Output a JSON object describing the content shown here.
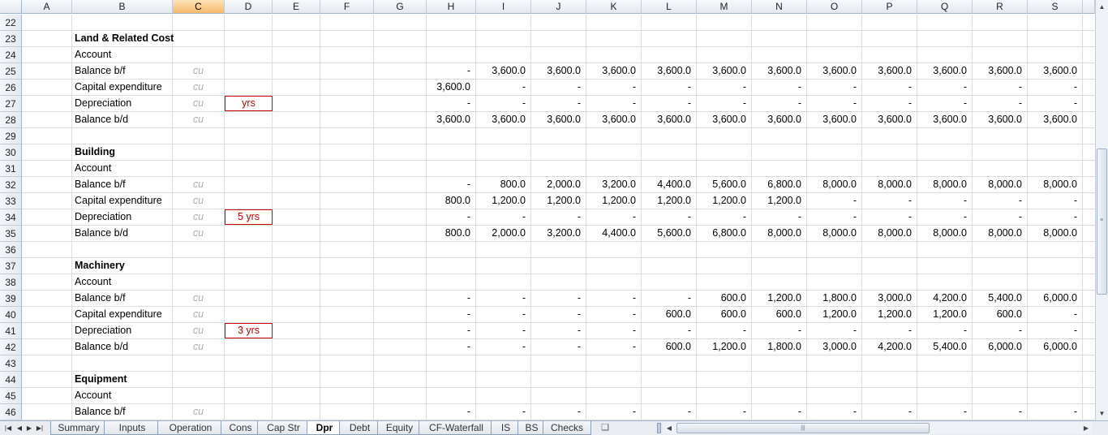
{
  "columns": [
    "A",
    "B",
    "C",
    "D",
    "E",
    "F",
    "G",
    "H",
    "I",
    "J",
    "K",
    "L",
    "M",
    "N",
    "O",
    "P",
    "Q",
    "R",
    "S"
  ],
  "selected_column": "C",
  "rows": [
    {
      "num": "22",
      "b": "",
      "bold": false,
      "unit": "",
      "box": "",
      "vals": [
        "",
        "",
        "",
        "",
        "",
        "",
        "",
        "",
        "",
        "",
        "",
        ""
      ]
    },
    {
      "num": "23",
      "b": "Land & Related Cost",
      "bold": true,
      "unit": "",
      "box": "",
      "vals": [
        "",
        "",
        "",
        "",
        "",
        "",
        "",
        "",
        "",
        "",
        "",
        ""
      ]
    },
    {
      "num": "24",
      "b": "Account",
      "bold": false,
      "unit": "",
      "box": "",
      "vals": [
        "",
        "",
        "",
        "",
        "",
        "",
        "",
        "",
        "",
        "",
        "",
        ""
      ]
    },
    {
      "num": "25",
      "b": "Balance b/f",
      "bold": false,
      "unit": "cu",
      "box": "",
      "vals": [
        "-",
        "3,600.0",
        "3,600.0",
        "3,600.0",
        "3,600.0",
        "3,600.0",
        "3,600.0",
        "3,600.0",
        "3,600.0",
        "3,600.0",
        "3,600.0",
        "3,600.0"
      ]
    },
    {
      "num": "26",
      "b": "Capital expenditure",
      "bold": false,
      "unit": "cu",
      "box": "",
      "vals": [
        "3,600.0",
        "-",
        "-",
        "-",
        "-",
        "-",
        "-",
        "-",
        "-",
        "-",
        "-",
        "-"
      ]
    },
    {
      "num": "27",
      "b": "Depreciation",
      "bold": false,
      "unit": "cu",
      "box": "yrs",
      "vals": [
        "-",
        "-",
        "-",
        "-",
        "-",
        "-",
        "-",
        "-",
        "-",
        "-",
        "-",
        "-"
      ]
    },
    {
      "num": "28",
      "b": "Balance b/d",
      "bold": false,
      "unit": "cu",
      "box": "",
      "vals": [
        "3,600.0",
        "3,600.0",
        "3,600.0",
        "3,600.0",
        "3,600.0",
        "3,600.0",
        "3,600.0",
        "3,600.0",
        "3,600.0",
        "3,600.0",
        "3,600.0",
        "3,600.0"
      ]
    },
    {
      "num": "29",
      "b": "",
      "bold": false,
      "unit": "",
      "box": "",
      "vals": [
        "",
        "",
        "",
        "",
        "",
        "",
        "",
        "",
        "",
        "",
        "",
        ""
      ]
    },
    {
      "num": "30",
      "b": "Building",
      "bold": true,
      "unit": "",
      "box": "",
      "vals": [
        "",
        "",
        "",
        "",
        "",
        "",
        "",
        "",
        "",
        "",
        "",
        ""
      ]
    },
    {
      "num": "31",
      "b": "Account",
      "bold": false,
      "unit": "",
      "box": "",
      "vals": [
        "",
        "",
        "",
        "",
        "",
        "",
        "",
        "",
        "",
        "",
        "",
        ""
      ]
    },
    {
      "num": "32",
      "b": "Balance b/f",
      "bold": false,
      "unit": "cu",
      "box": "",
      "vals": [
        "-",
        "800.0",
        "2,000.0",
        "3,200.0",
        "4,400.0",
        "5,600.0",
        "6,800.0",
        "8,000.0",
        "8,000.0",
        "8,000.0",
        "8,000.0",
        "8,000.0"
      ]
    },
    {
      "num": "33",
      "b": "Capital expenditure",
      "bold": false,
      "unit": "cu",
      "box": "",
      "vals": [
        "800.0",
        "1,200.0",
        "1,200.0",
        "1,200.0",
        "1,200.0",
        "1,200.0",
        "1,200.0",
        "-",
        "-",
        "-",
        "-",
        "-"
      ]
    },
    {
      "num": "34",
      "b": "Depreciation",
      "bold": false,
      "unit": "cu",
      "box": "5 yrs",
      "vals": [
        "-",
        "-",
        "-",
        "-",
        "-",
        "-",
        "-",
        "-",
        "-",
        "-",
        "-",
        "-"
      ]
    },
    {
      "num": "35",
      "b": "Balance b/d",
      "bold": false,
      "unit": "cu",
      "box": "",
      "vals": [
        "800.0",
        "2,000.0",
        "3,200.0",
        "4,400.0",
        "5,600.0",
        "6,800.0",
        "8,000.0",
        "8,000.0",
        "8,000.0",
        "8,000.0",
        "8,000.0",
        "8,000.0"
      ]
    },
    {
      "num": "36",
      "b": "",
      "bold": false,
      "unit": "",
      "box": "",
      "vals": [
        "",
        "",
        "",
        "",
        "",
        "",
        "",
        "",
        "",
        "",
        "",
        ""
      ]
    },
    {
      "num": "37",
      "b": "Machinery",
      "bold": true,
      "unit": "",
      "box": "",
      "vals": [
        "",
        "",
        "",
        "",
        "",
        "",
        "",
        "",
        "",
        "",
        "",
        ""
      ]
    },
    {
      "num": "38",
      "b": "Account",
      "bold": false,
      "unit": "",
      "box": "",
      "vals": [
        "",
        "",
        "",
        "",
        "",
        "",
        "",
        "",
        "",
        "",
        "",
        ""
      ]
    },
    {
      "num": "39",
      "b": "Balance b/f",
      "bold": false,
      "unit": "cu",
      "box": "",
      "vals": [
        "-",
        "-",
        "-",
        "-",
        "-",
        "600.0",
        "1,200.0",
        "1,800.0",
        "3,000.0",
        "4,200.0",
        "5,400.0",
        "6,000.0"
      ]
    },
    {
      "num": "40",
      "b": "Capital expenditure",
      "bold": false,
      "unit": "cu",
      "box": "",
      "vals": [
        "-",
        "-",
        "-",
        "-",
        "600.0",
        "600.0",
        "600.0",
        "1,200.0",
        "1,200.0",
        "1,200.0",
        "600.0",
        "-"
      ]
    },
    {
      "num": "41",
      "b": "Depreciation",
      "bold": false,
      "unit": "cu",
      "box": "3 yrs",
      "vals": [
        "-",
        "-",
        "-",
        "-",
        "-",
        "-",
        "-",
        "-",
        "-",
        "-",
        "-",
        "-"
      ]
    },
    {
      "num": "42",
      "b": "Balance b/d",
      "bold": false,
      "unit": "cu",
      "box": "",
      "vals": [
        "-",
        "-",
        "-",
        "-",
        "600.0",
        "1,200.0",
        "1,800.0",
        "3,000.0",
        "4,200.0",
        "5,400.0",
        "6,000.0",
        "6,000.0"
      ]
    },
    {
      "num": "43",
      "b": "",
      "bold": false,
      "unit": "",
      "box": "",
      "vals": [
        "",
        "",
        "",
        "",
        "",
        "",
        "",
        "",
        "",
        "",
        "",
        ""
      ]
    },
    {
      "num": "44",
      "b": "Equipment",
      "bold": true,
      "unit": "",
      "box": "",
      "vals": [
        "",
        "",
        "",
        "",
        "",
        "",
        "",
        "",
        "",
        "",
        "",
        ""
      ]
    },
    {
      "num": "45",
      "b": "Account",
      "bold": false,
      "unit": "",
      "box": "",
      "vals": [
        "",
        "",
        "",
        "",
        "",
        "",
        "",
        "",
        "",
        "",
        "",
        ""
      ]
    },
    {
      "num": "46",
      "b": "Balance b/f",
      "bold": false,
      "unit": "cu",
      "box": "",
      "vals": [
        "-",
        "-",
        "-",
        "-",
        "-",
        "-",
        "-",
        "-",
        "-",
        "-",
        "-",
        "-"
      ]
    }
  ],
  "tabs": [
    "Summary",
    "Inputs",
    "Operation",
    "Cons",
    "Cap Str",
    "Dpr",
    "Debt",
    "Equity",
    "CF-Waterfall",
    "IS",
    "BS",
    "Checks"
  ],
  "active_tab": "Dpr",
  "icons": {
    "nav_first": "first-sheet-icon",
    "nav_prev": "prev-sheet-icon",
    "nav_next": "next-sheet-icon",
    "nav_last": "last-sheet-icon",
    "insert_sheet": "insert-sheet-icon"
  },
  "colors": {
    "box_red": "#cc0000",
    "selected_header": "#f7b96a"
  }
}
